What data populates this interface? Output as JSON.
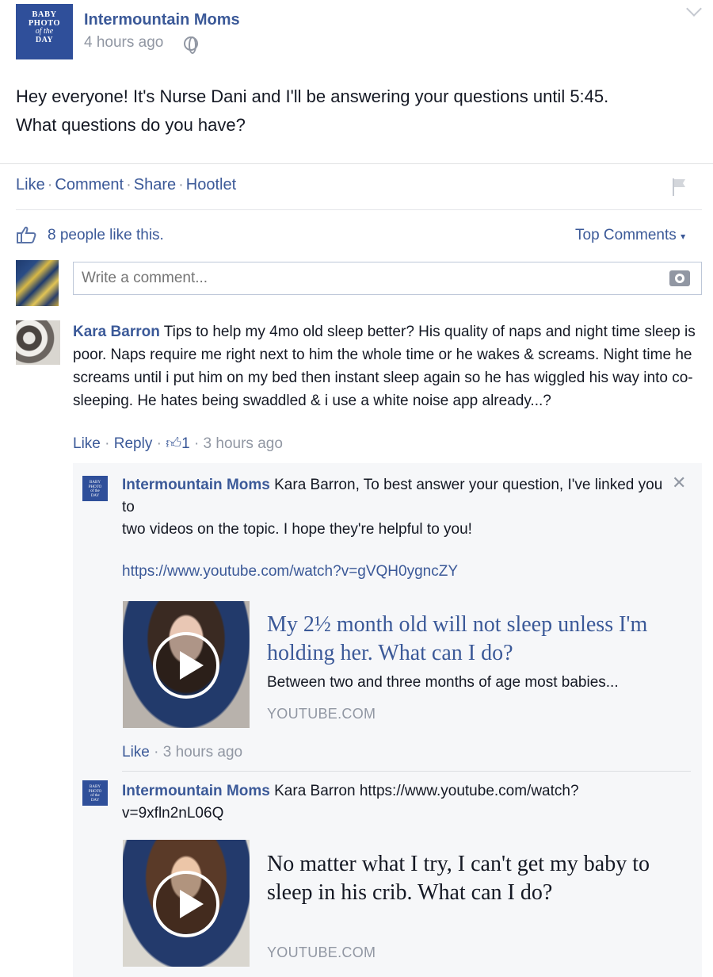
{
  "post": {
    "logo": [
      "BABY",
      "PHOTO",
      "of the",
      "DAY"
    ],
    "author": "Intermountain Moms",
    "time": "4 hours ago",
    "body_line1": "Hey everyone! It's Nurse Dani and I'll be answering your questions until 5:45.",
    "body_line2": "What questions do you have?"
  },
  "actions": {
    "like": "Like",
    "comment": "Comment",
    "share": "Share",
    "hootlet": "Hootlet",
    "separator": "·"
  },
  "likes": {
    "text": "8 people like this.",
    "top_comments": "Top Comments"
  },
  "comment_input": {
    "placeholder": "Write a comment..."
  },
  "comment1": {
    "author": "Kara Barron",
    "text": "Tips to help my 4mo old sleep better? His quality of naps and night time sleep is poor. Naps require me right next to him the whole time or he wakes & screams. Night time he screams until i put him on my bed then instant sleep again so he has wiggled his way into co-sleeping. He hates being swaddled & i use a white noise app already...?",
    "like": "Like",
    "reply": "Reply",
    "like_count": "1",
    "time": "3 hours ago"
  },
  "reply1": {
    "author": "Intermountain Moms",
    "text_line1": "Kara Barron, To best answer your question, I've linked you to",
    "text_line2": "two videos on the topic. I hope they're helpful to you!",
    "link": "https://www.youtube.com/watch?v=gVQH0ygncZY",
    "video_title": "My 2½ month old will not sleep unless I'm holding her. What can I do?",
    "video_desc": "Between two and three months of age most babies...",
    "video_source": "YOUTUBE.COM",
    "like": "Like",
    "time": "3 hours ago"
  },
  "reply2": {
    "author": "Intermountain Moms",
    "text": "Kara Barron https://www.youtube.com/watch?v=9xfln2nL06Q",
    "video_title": "No matter what I try, I can't get my baby to sleep in his crib. What can I do?",
    "video_source": "YOUTUBE.COM"
  },
  "colors": {
    "link_blue": "#3b5998",
    "grey_text": "#9197a3",
    "panel_bg": "#f6f7f9"
  }
}
